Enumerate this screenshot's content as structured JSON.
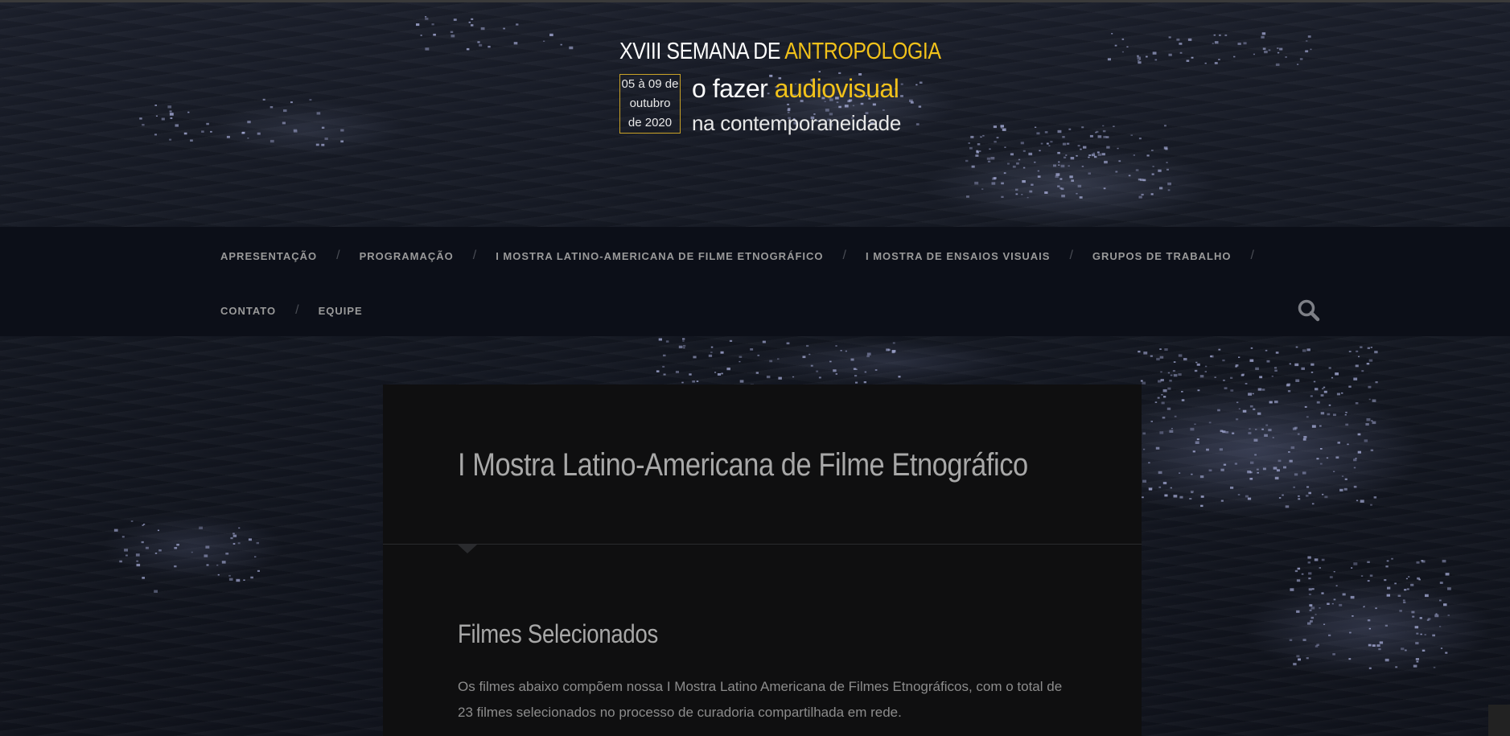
{
  "header": {
    "line1_prefix": "XVIII SEMANA DE ",
    "line1_highlight": "ANTROPOLOGIA",
    "date_lines": [
      "05 à 09 de",
      "outubro",
      "de 2020"
    ],
    "line2_prefix": "o fazer ",
    "line2_highlight": "audiovisual",
    "line3": "na contemporaneidade"
  },
  "nav": {
    "row1": [
      "APRESENTAÇÃO",
      "PROGRAMAÇÃO",
      "I MOSTRA LATINO-AMERICANA DE FILME ETNOGRÁFICO",
      "I MOSTRA DE ENSAIOS VISUAIS",
      "GRUPOS DE TRABALHO"
    ],
    "row2": [
      "CONTATO",
      "EQUIPE"
    ],
    "separator": "/"
  },
  "main": {
    "title": "I Mostra Latino-Americana de Filme Etnográfico",
    "section_title": "Filmes Selecionados",
    "section_text": "Os filmes abaixo compõem nossa I Mostra Latino Americana de Filmes Etnográficos, com o total de 23 filmes selecionados no processo de curadoria compartilhada em rede."
  },
  "icons": {
    "search": "search-icon"
  },
  "colors": {
    "accent": "#f2c21a",
    "nav_bg": "#0c0f18",
    "card_bg": "#0f0f10"
  }
}
